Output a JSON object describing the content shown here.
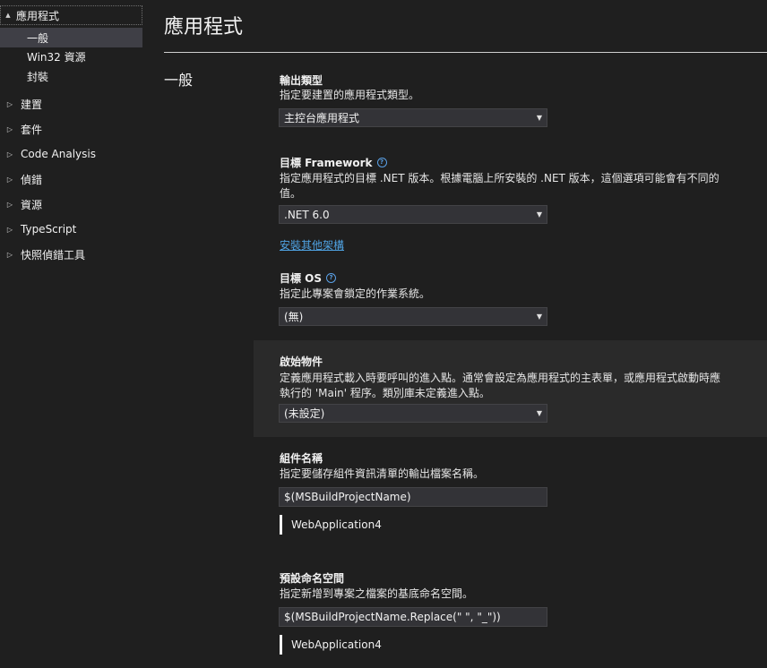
{
  "sidebar": {
    "items": [
      {
        "label": "應用程式",
        "expanded": true
      },
      {
        "label": "一般"
      },
      {
        "label": "Win32 資源"
      },
      {
        "label": "封裝"
      },
      {
        "label": "建置"
      },
      {
        "label": "套件"
      },
      {
        "label": "Code Analysis"
      },
      {
        "label": "偵錯"
      },
      {
        "label": "資源"
      },
      {
        "label": "TypeScript"
      },
      {
        "label": "快照偵錯工具"
      }
    ]
  },
  "page": {
    "title": "應用程式",
    "section": "一般"
  },
  "props": {
    "output_type": {
      "title": "輸出類型",
      "desc": "指定要建置的應用程式類型。",
      "value": "主控台應用程式"
    },
    "target_framework": {
      "title": "目標 Framework",
      "desc": "指定應用程式的目標 .NET 版本。根據電腦上所安裝的 .NET 版本，這個選項可能會有不同的值。",
      "value": ".NET 6.0",
      "link": "安裝其他架構"
    },
    "target_os": {
      "title": "目標 OS",
      "desc": "指定此專案會鎖定的作業系統。",
      "value": "(無)"
    },
    "startup_object": {
      "title": "啟始物件",
      "desc": "定義應用程式載入時要呼叫的進入點。通常會設定為應用程式的主表單，或應用程式啟動時應執行的 'Main' 程序。類別庫未定義進入點。",
      "value": "(未設定)"
    },
    "assembly_name": {
      "title": "組件名稱",
      "desc": "指定要儲存組件資訊清單的輸出檔案名稱。",
      "value": "$(MSBuildProjectName)",
      "evaluated": "WebApplication4"
    },
    "default_namespace": {
      "title": "預設命名空間",
      "desc": "指定新增到專案之檔案的基底命名空間。",
      "value": "$(MSBuildProjectName.Replace(\" \", \"_\"))",
      "evaluated": "WebApplication4"
    }
  },
  "icons": {
    "expanded": "▲",
    "collapsed": "▷",
    "combo_caret": "▼",
    "help": "?"
  },
  "colors": {
    "background": "#1f1f1f",
    "selected": "#3f3f46",
    "link": "#4fa3e3",
    "highlight": "#2a2a2a"
  }
}
